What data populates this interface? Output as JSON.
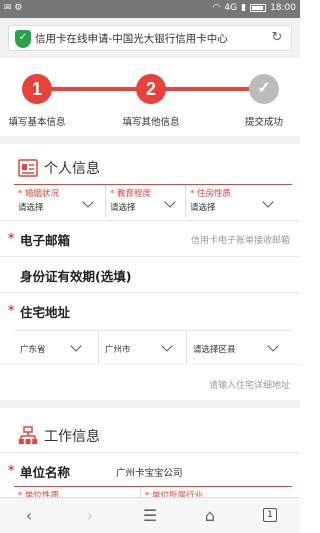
{
  "statusbar": {
    "time": "18:00",
    "network": "4G"
  },
  "browser": {
    "url_title": "信用卡在线申请-中国光大银行信用卡中心",
    "tab_count": "1"
  },
  "steps": [
    {
      "number": "1",
      "label": "填写基本信息",
      "state": "active"
    },
    {
      "number": "2",
      "label": "填写其他信息",
      "state": "active"
    },
    {
      "number": "",
      "label": "提交成功",
      "state": "done"
    }
  ],
  "personal": {
    "title": "个人信息",
    "selects": [
      {
        "label": "* 婚姻状况",
        "value": "请选择"
      },
      {
        "label": "* 教育程度",
        "value": "请选择"
      },
      {
        "label": "* 住房性质",
        "value": "请选择"
      }
    ],
    "email": {
      "star": "*",
      "label": "电子邮箱",
      "hint": "信用卡电子账单接收邮箱"
    },
    "id_validity": {
      "label": "身份证有效期(选填)"
    },
    "address": {
      "star": "*",
      "label": "住宅地址",
      "province": "广东省",
      "city": "广州市",
      "district": "请选择区县",
      "detail_placeholder": "请输入住宅详细地址"
    }
  },
  "work": {
    "title": "工作信息",
    "company": {
      "star": "*",
      "label": "单位名称",
      "value": "广州卡宝宝公司"
    },
    "selects": [
      {
        "label": "* 单位性质"
      },
      {
        "label": "* 单位所属行业"
      }
    ]
  },
  "colors": {
    "accent": "#e8423a",
    "step_done": "#bcbcbc",
    "divider": "#f2f2f2"
  }
}
